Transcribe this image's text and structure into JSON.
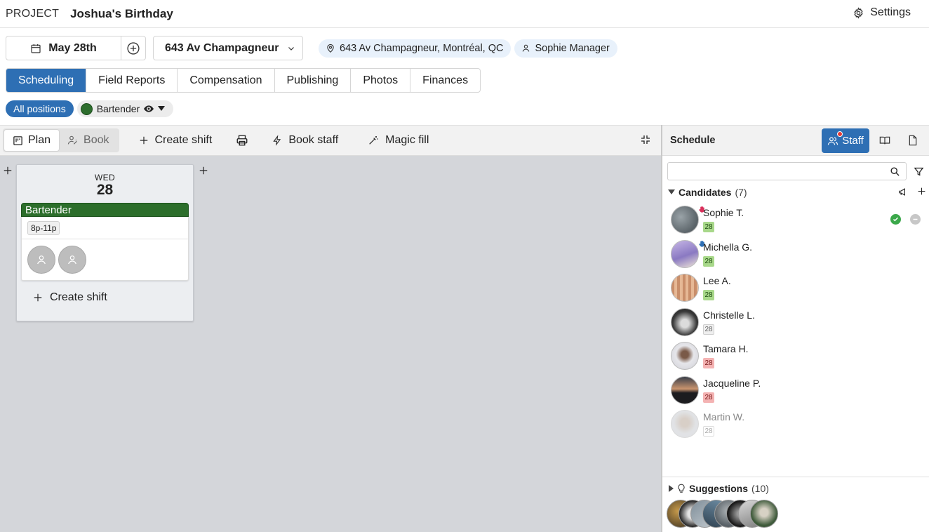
{
  "header": {
    "label": "PROJECT",
    "project_title": "Joshua's Birthday",
    "settings_label": "Settings"
  },
  "controls": {
    "date": "May 28th",
    "venue": "643 Av Champagneur",
    "address": "643 Av Champagneur, Montréal, QC",
    "manager": "Sophie Manager"
  },
  "tabs": [
    {
      "label": "Scheduling",
      "active": true
    },
    {
      "label": "Field Reports"
    },
    {
      "label": "Compensation"
    },
    {
      "label": "Publishing"
    },
    {
      "label": "Photos"
    },
    {
      "label": "Finances"
    }
  ],
  "positions": {
    "all_label": "All positions",
    "items": [
      {
        "label": "Bartender",
        "color": "#2c6e2b"
      }
    ]
  },
  "toolbar": {
    "plan_label": "Plan",
    "book_label": "Book",
    "create_shift_label": "Create shift",
    "book_staff_label": "Book staff",
    "magic_fill_label": "Magic fill"
  },
  "day": {
    "dow": "WED",
    "dom": "28",
    "shift_name": "Bartender",
    "shift_time": "8p-11p",
    "create_shift_label": "Create shift"
  },
  "panel": {
    "title": "Schedule",
    "staff_label": "Staff",
    "search_placeholder": "",
    "candidates_label": "Candidates",
    "candidates_count": "(7)",
    "suggestions_label": "Suggestions",
    "suggestions_count": "(10)",
    "candidates": [
      {
        "name": "Sophie T.",
        "day": "28",
        "status": "green",
        "hand": "red"
      },
      {
        "name": "Michella G.",
        "day": "28",
        "status": "green",
        "hand": "blue"
      },
      {
        "name": "Lee A.",
        "day": "28",
        "status": "green"
      },
      {
        "name": "Christelle L.",
        "day": "28",
        "status": "grey"
      },
      {
        "name": "Tamara H.",
        "day": "28",
        "status": "red"
      },
      {
        "name": "Jacqueline P.",
        "day": "28",
        "status": "red"
      },
      {
        "name": "Martin W.",
        "day": "28",
        "status": "faded"
      }
    ]
  },
  "colors": {
    "accent": "#2e6fb4",
    "position_green": "#2c6e2b",
    "available": "#a8d88a",
    "unavailable": "#f4b3b3"
  }
}
